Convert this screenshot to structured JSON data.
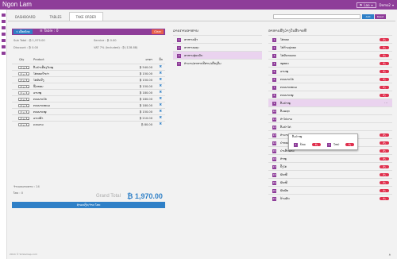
{
  "topbar": {
    "brand": "Ngon Lam",
    "lang": "Lao",
    "user": "Demo2",
    "arrow": "▾"
  },
  "nav": {
    "tabs": [
      "DASHBOARD",
      "TABLES",
      "TAKE ORDER"
    ]
  },
  "search": {
    "placeholder": "",
    "add_label": "Add",
    "reset_label": "Reset"
  },
  "order": {
    "back_label": "< ເລືອກໂຕະ",
    "table_title": "≡ Table : 0",
    "clear_label": "Clear",
    "subtotal": "Sub Total : ₿ 1,970.00",
    "service": "Service : ₿ 0.00",
    "discount": "Discount : ₿ 0.00",
    "vat": "VAT 7% (Included) : ₿ (128.88)",
    "col_qty": "Qty",
    "col_product": "Product",
    "col_price": "ລາຄາ",
    "col_del": "ລຶບ",
    "items": [
      {
        "qty": "3",
        "name": "ຕົ້ມຍຳເຄືອງໃນໝູ",
        "price": "₿ 540.00"
      },
      {
        "qty": "1",
        "name": "ໄກ່ທອດນ້ຳປາ",
        "price": "₿ 150.00"
      },
      {
        "qty": "1",
        "name": "ໄກ່ຜັດຂີງ",
        "price": "₿ 150.00"
      },
      {
        "qty": "1",
        "name": "ຊີ້ນຫອຍ",
        "price": "₿ 150.00"
      },
      {
        "qty": "1",
        "name": "ລາບໝູ",
        "price": "₿ 180.00"
      },
      {
        "qty": "1",
        "name": "ກະເພາະໄກ່",
        "price": "₿ 180.00"
      },
      {
        "qty": "1",
        "name": "ກະເພາະທະເລ",
        "price": "₿ 180.00"
      },
      {
        "qty": "1",
        "name": "ກະເພາະໝູ",
        "price": "₿ 150.00"
      },
      {
        "qty": "1",
        "name": "ລາດໜ້າ",
        "price": "₿ 210.00"
      },
      {
        "qty": "1",
        "name": "ເບຍລາວ",
        "price": "₿ 80.00"
      }
    ],
    "item_count": "ຈຳນວນລາຍການ : 14",
    "table_label": "ໂຕະ : 0",
    "grand_label": "Grand Total",
    "grand_value": "₿ 1,970.00",
    "pay_label": "ຊຳລະເງິນ/ຈ່າຍ ໂຕະ"
  },
  "categories": {
    "title": "ລາຍການອາຫານ",
    "items": [
      "ອາຫານເຊ້າ",
      "ອາຫານແຊບ",
      "ອາຫານສູ່ຂະວັນ",
      "ຕຳລາບ/ອາຫານອີສານ/ເຄື່ອງດື່ມ"
    ],
    "selected_index": 2
  },
  "menu": {
    "title": "ອາຫານສິ່ງວ່າງໃນສີ່ບາຍທີ່",
    "items": [
      {
        "name": "ໄກ່ທອດ",
        "badge": "ສັ່ງ"
      },
      {
        "name": "ໄກ່ກ້າມປູທອດ",
        "badge": "ສັ່ງ"
      },
      {
        "name": "ໄກ່ຜັດກະເທຍ",
        "badge": "ສັ່ງ"
      },
      {
        "name": "ໝູທອດ",
        "badge": "ສັ່ງ"
      },
      {
        "name": "ລາບໝູ",
        "badge": "ສັ່ງ"
      },
      {
        "name": "ກະເພາະໄກ່",
        "badge": "ສັ່ງ"
      },
      {
        "name": "ກະເພາະທະເລ",
        "badge": "ສັ່ງ"
      },
      {
        "name": "ກະເພາະໝູ",
        "badge": "ສັ່ງ"
      },
      {
        "name": "ຕົ້ມຍຳໝູ",
        "badge": ""
      },
      {
        "name": "ຕົ້ມແຊບ",
        "badge": ""
      },
      {
        "name": "ຕຳໄຂ່ດາວ",
        "badge": ""
      },
      {
        "name": "ຕົ້ມຍຳໄກ່",
        "badge": ""
      },
      {
        "name": "ຕຳລາບໝູ",
        "badge": "ສັ່ງ"
      },
      {
        "name": "ຍຳທະເລ",
        "badge": "ສັ່ງ"
      },
      {
        "name": "ຍຳເສັ້ນແກ້ວ",
        "badge": "ສັ່ງ"
      },
      {
        "name": "ຕຳໝູ",
        "badge": "ສັ່ງ"
      },
      {
        "name": "ປີ້ງໄກ່",
        "badge": "ສັ່ງ"
      },
      {
        "name": "ຜັດໝີ່",
        "badge": "ສັ່ງ"
      },
      {
        "name": "ຜັດໝີ",
        "badge": "ສັ່ງ"
      },
      {
        "name": "ຜັດຜັກ",
        "badge": "ສັ່ງ"
      },
      {
        "name": "ຂ້າວຜັດ",
        "badge": "ສັ່ງ"
      }
    ],
    "selected_index": 8,
    "kebab": "⋯"
  },
  "popup": {
    "title": "ຕົ້ມຍຳໝູ",
    "options": [
      {
        "num": "1",
        "name": "ນ້ອຍ",
        "badge": "ສັ່ງ"
      },
      {
        "num": "2",
        "name": "ໃຫຍ່",
        "badge": "ສັ່ງ"
      }
    ]
  },
  "footer": {
    "left": "2014 © Smilemap.com",
    "right": "▲"
  },
  "colors": {
    "brand": "#8e3d99",
    "accent": "#2f80c7",
    "badge": "#e0304e",
    "clear": "#e8604c",
    "selected": "#ead3ef"
  }
}
